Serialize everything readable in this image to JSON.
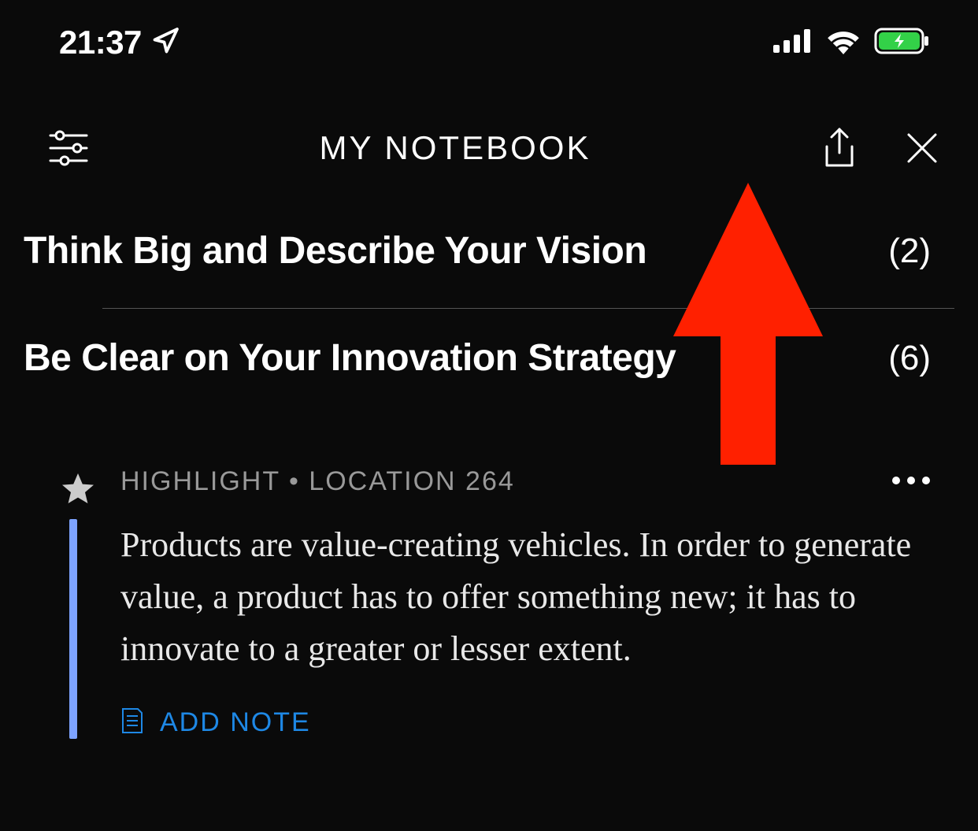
{
  "statusBar": {
    "time": "21:37"
  },
  "header": {
    "title": "MY NOTEBOOK"
  },
  "sections": [
    {
      "title": "Think Big and Describe Your Vision",
      "count": "(2)"
    },
    {
      "title": "Be Clear on Your Innovation Strategy",
      "count": "(6)"
    }
  ],
  "highlight": {
    "meta": "HIGHLIGHT • LOCATION 264",
    "text": "Products are value-creating vehicles. In order to generate value, a product has to offer something new; it has to innovate to a greater or lesser extent.",
    "addNoteLabel": "ADD NOTE"
  },
  "colors": {
    "accent": "#1e88e5",
    "highlightBar": "#7da3ff",
    "arrow": "#ff2000",
    "batteryFill": "#33d148"
  }
}
